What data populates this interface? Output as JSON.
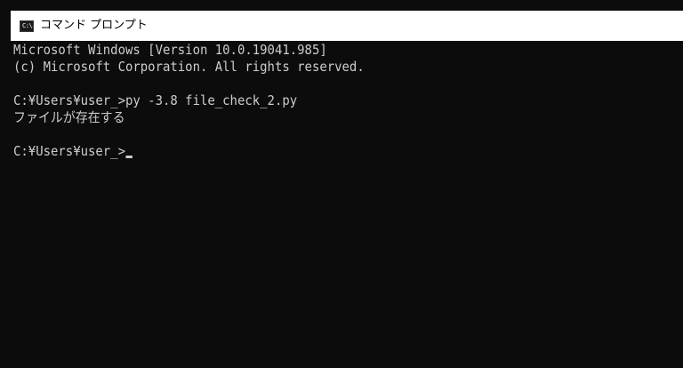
{
  "window": {
    "title": "コマンド プロンプト",
    "icon": "command-prompt-icon",
    "icon_text": "C:\\."
  },
  "console": {
    "lines": [
      "Microsoft Windows [Version 10.0.19041.985]",
      "(c) Microsoft Corporation. All rights reserved.",
      "",
      "C:¥Users¥user_>py -3.8 file_check_2.py",
      "ファイルが存在する",
      "",
      "C:¥Users¥user_>"
    ],
    "cursor": "_"
  },
  "colors": {
    "background": "#0c0c0c",
    "text": "#cccccc",
    "titlebar": "#ffffff"
  }
}
